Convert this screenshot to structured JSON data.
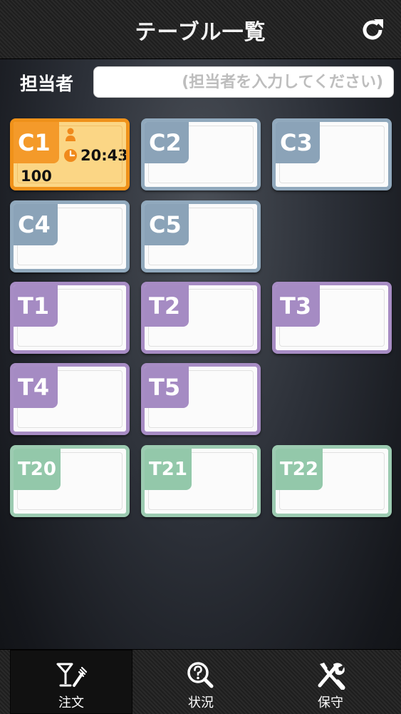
{
  "header": {
    "title": "テーブル一覧",
    "refresh_icon": "refresh-icon"
  },
  "staff": {
    "label": "担当者",
    "placeholder": "(担当者を入力してください)",
    "value": ""
  },
  "tables": {
    "C1": {
      "label": "C1",
      "time": "20:43",
      "amount": "100",
      "status": "active",
      "color": "#f49a2a"
    },
    "C2": {
      "label": "C2",
      "color": "#8ba3b8"
    },
    "C3": {
      "label": "C3",
      "color": "#8ba3b8"
    },
    "C4": {
      "label": "C4",
      "color": "#8ba3b8"
    },
    "C5": {
      "label": "C5",
      "color": "#8ba3b8"
    },
    "T1": {
      "label": "T1",
      "color": "#a58bc3"
    },
    "T2": {
      "label": "T2",
      "color": "#a58bc3"
    },
    "T3": {
      "label": "T3",
      "color": "#a58bc3"
    },
    "T4": {
      "label": "T4",
      "color": "#a58bc3"
    },
    "T5": {
      "label": "T5",
      "color": "#a58bc3"
    },
    "T20": {
      "label": "T20",
      "color": "#93c8aa"
    },
    "T21": {
      "label": "T21",
      "color": "#93c8aa"
    },
    "T22": {
      "label": "T22",
      "color": "#93c8aa"
    }
  },
  "tabs": [
    {
      "label": "注文",
      "icon": "cocktail-fork-icon",
      "selected": true
    },
    {
      "label": "状況",
      "icon": "search-question-icon",
      "selected": false
    },
    {
      "label": "保守",
      "icon": "tools-icon",
      "selected": false
    }
  ]
}
